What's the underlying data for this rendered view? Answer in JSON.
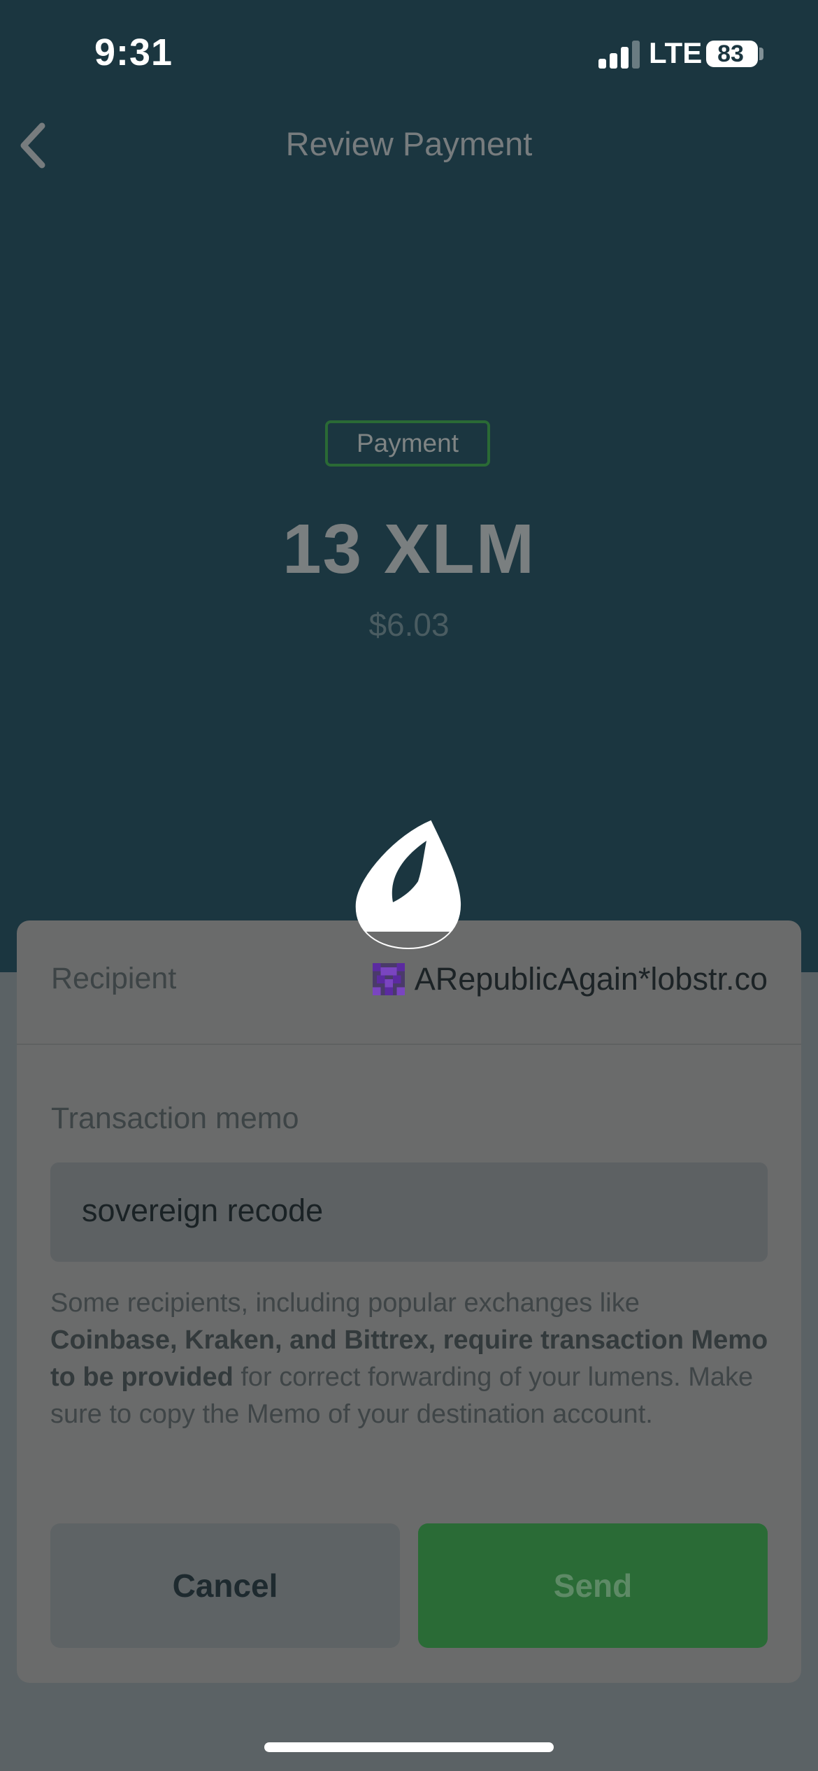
{
  "status_bar": {
    "time": "9:31",
    "network": "LTE",
    "battery": "83"
  },
  "header": {
    "title": "Review Payment",
    "back_icon": "chevron-left-icon"
  },
  "payment": {
    "badge": "Payment",
    "amount": "13 XLM",
    "fiat_value": "$6.03"
  },
  "sheet": {
    "logo_icon": "lobstr-logo-icon",
    "recipient_label": "Recipient",
    "recipient_name": "ARepublicAgain*lobstr.co",
    "memo_label": "Transaction memo",
    "memo_value": "sovereign recode",
    "memo_hint_part1": "Some recipients, including popular exchanges like ",
    "memo_hint_bold": "Coinbase, Kraken, and Bittrex, require transaction Memo to be provided",
    "memo_hint_part2": " for correct forwarding of your lumens. Make sure to copy the Memo of your destination account.",
    "cancel_label": "Cancel",
    "send_label": "Send"
  },
  "colors": {
    "header_background": "#1b3640",
    "accent_green": "#2a6b36",
    "overlay_background": "#5b6265"
  }
}
